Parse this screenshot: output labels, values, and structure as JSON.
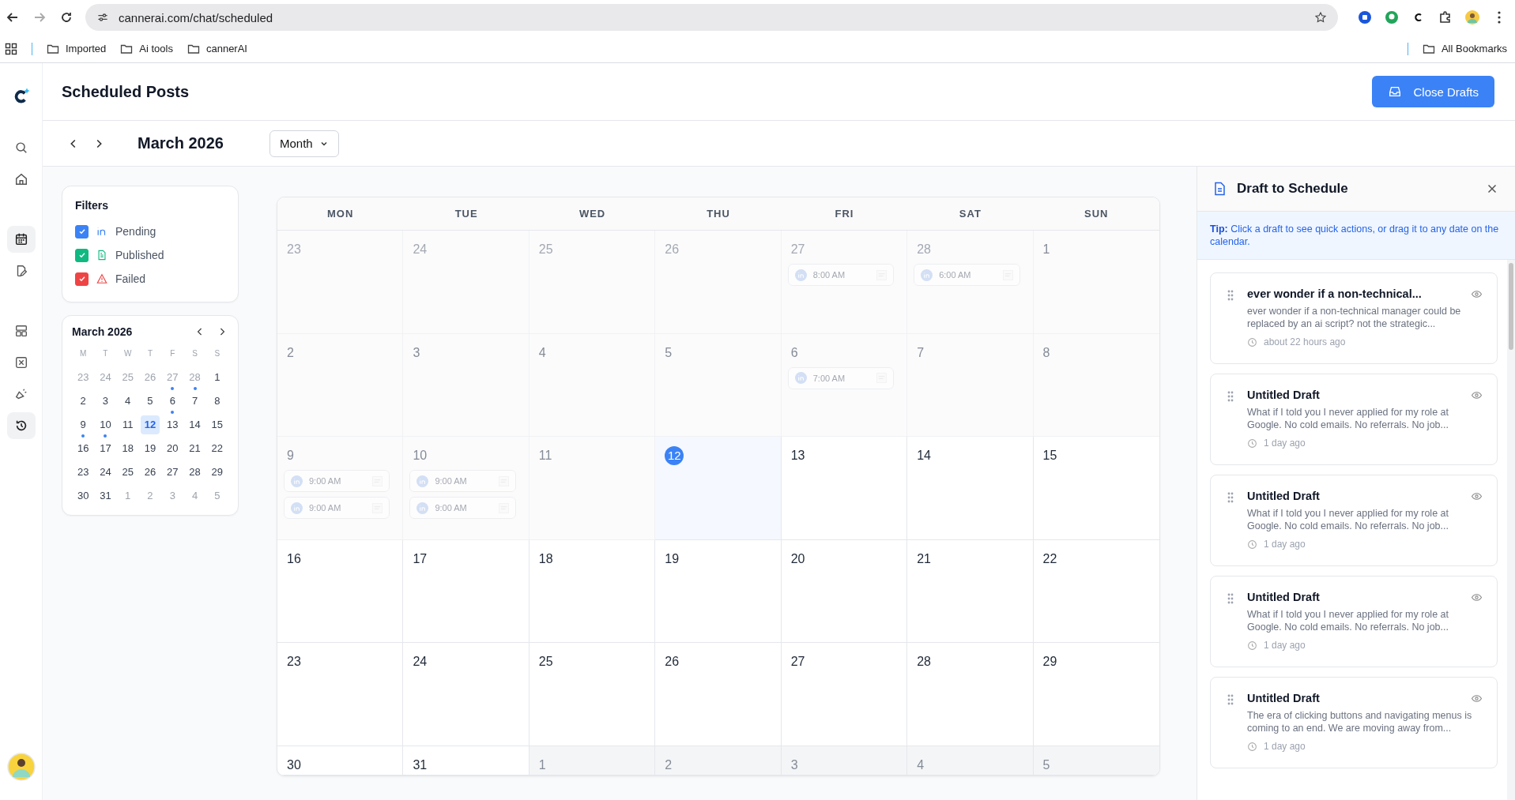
{
  "browser": {
    "url": "cannerai.com/chat/scheduled",
    "bookmarks": [
      {
        "label": "Imported"
      },
      {
        "label": "Ai tools"
      },
      {
        "label": "cannerAI"
      }
    ],
    "all_bookmarks": "All Bookmarks"
  },
  "sidebar": {
    "items": [
      {
        "kind": "search",
        "selected": false
      },
      {
        "kind": "home",
        "selected": false
      },
      {
        "kind": "calendar",
        "selected": true
      },
      {
        "kind": "edit",
        "selected": false
      },
      {
        "kind": "layout",
        "selected": false
      },
      {
        "kind": "box",
        "selected": false
      },
      {
        "kind": "megaphone",
        "selected": false
      },
      {
        "kind": "history",
        "selected": true
      }
    ]
  },
  "header": {
    "title": "Scheduled Posts",
    "button": "Close Drafts"
  },
  "toolbar": {
    "month": "March 2026",
    "view": "Month"
  },
  "filters": {
    "title": "Filters",
    "items": [
      {
        "kind": "linkedin",
        "label": "Pending",
        "checked": true,
        "color": "#3b82f6"
      },
      {
        "kind": "document",
        "label": "Published",
        "checked": true,
        "color": "#10b981"
      },
      {
        "kind": "warning",
        "label": "Failed",
        "checked": true,
        "color": "#ef4444"
      }
    ]
  },
  "mini_calendar": {
    "title": "March 2026",
    "weekdays": [
      "M",
      "T",
      "W",
      "T",
      "F",
      "S",
      "S"
    ],
    "days": [
      {
        "label": "23",
        "outside": true,
        "selected": false,
        "has_posts": false
      },
      {
        "label": "24",
        "outside": true,
        "selected": false,
        "has_posts": false
      },
      {
        "label": "25",
        "outside": true,
        "selected": false,
        "has_posts": false
      },
      {
        "label": "26",
        "outside": true,
        "selected": false,
        "has_posts": false
      },
      {
        "label": "27",
        "outside": true,
        "selected": false,
        "has_posts": true
      },
      {
        "label": "28",
        "outside": true,
        "selected": false,
        "has_posts": true
      },
      {
        "label": "1",
        "outside": false,
        "selected": false,
        "has_posts": false
      },
      {
        "label": "2",
        "outside": false,
        "selected": false,
        "has_posts": false
      },
      {
        "label": "3",
        "outside": false,
        "selected": false,
        "has_posts": false
      },
      {
        "label": "4",
        "outside": false,
        "selected": false,
        "has_posts": false
      },
      {
        "label": "5",
        "outside": false,
        "selected": false,
        "has_posts": false
      },
      {
        "label": "6",
        "outside": false,
        "selected": false,
        "has_posts": true
      },
      {
        "label": "7",
        "outside": false,
        "selected": false,
        "has_posts": false
      },
      {
        "label": "8",
        "outside": false,
        "selected": false,
        "has_posts": false
      },
      {
        "label": "9",
        "outside": false,
        "selected": false,
        "has_posts": true
      },
      {
        "label": "10",
        "outside": false,
        "selected": false,
        "has_posts": true
      },
      {
        "label": "11",
        "outside": false,
        "selected": false,
        "has_posts": false
      },
      {
        "label": "12",
        "outside": false,
        "selected": true,
        "has_posts": false
      },
      {
        "label": "13",
        "outside": false,
        "selected": false,
        "has_posts": false
      },
      {
        "label": "14",
        "outside": false,
        "selected": false,
        "has_posts": false
      },
      {
        "label": "15",
        "outside": false,
        "selected": false,
        "has_posts": false
      },
      {
        "label": "16",
        "outside": false,
        "selected": false,
        "has_posts": false
      },
      {
        "label": "17",
        "outside": false,
        "selected": false,
        "has_posts": false
      },
      {
        "label": "18",
        "outside": false,
        "selected": false,
        "has_posts": false
      },
      {
        "label": "19",
        "outside": false,
        "selected": false,
        "has_posts": false
      },
      {
        "label": "20",
        "outside": false,
        "selected": false,
        "has_posts": false
      },
      {
        "label": "21",
        "outside": false,
        "selected": false,
        "has_posts": false
      },
      {
        "label": "22",
        "outside": false,
        "selected": false,
        "has_posts": false
      },
      {
        "label": "23",
        "outside": false,
        "selected": false,
        "has_posts": false
      },
      {
        "label": "24",
        "outside": false,
        "selected": false,
        "has_posts": false
      },
      {
        "label": "25",
        "outside": false,
        "selected": false,
        "has_posts": false
      },
      {
        "label": "26",
        "outside": false,
        "selected": false,
        "has_posts": false
      },
      {
        "label": "27",
        "outside": false,
        "selected": false,
        "has_posts": false
      },
      {
        "label": "28",
        "outside": false,
        "selected": false,
        "has_posts": false
      },
      {
        "label": "29",
        "outside": false,
        "selected": false,
        "has_posts": false
      },
      {
        "label": "30",
        "outside": false,
        "selected": false,
        "has_posts": false
      },
      {
        "label": "31",
        "outside": false,
        "selected": false,
        "has_posts": false
      },
      {
        "label": "1",
        "outside": true,
        "selected": false,
        "has_posts": false
      },
      {
        "label": "2",
        "outside": true,
        "selected": false,
        "has_posts": false
      },
      {
        "label": "3",
        "outside": true,
        "selected": false,
        "has_posts": false
      },
      {
        "label": "4",
        "outside": true,
        "selected": false,
        "has_posts": false
      },
      {
        "label": "5",
        "outside": true,
        "selected": false,
        "has_posts": false
      }
    ]
  },
  "calendar": {
    "weekdays": [
      "MON",
      "TUE",
      "WED",
      "THU",
      "FRI",
      "SAT",
      "SUN"
    ],
    "days": [
      {
        "label": "23",
        "past": true,
        "outside": true,
        "today": false
      },
      {
        "label": "24",
        "past": true,
        "outside": true,
        "today": false
      },
      {
        "label": "25",
        "past": true,
        "outside": true,
        "today": false
      },
      {
        "label": "26",
        "past": true,
        "outside": true,
        "today": false
      },
      {
        "label": "27",
        "past": true,
        "outside": true,
        "today": false,
        "events": [
          {
            "time": "8:00 AM"
          }
        ]
      },
      {
        "label": "28",
        "past": true,
        "outside": true,
        "today": false,
        "events": [
          {
            "time": "6:00 AM"
          }
        ]
      },
      {
        "label": "1",
        "past": true,
        "outside": false,
        "today": false
      },
      {
        "label": "2",
        "past": true,
        "outside": false,
        "today": false
      },
      {
        "label": "3",
        "past": true,
        "outside": false,
        "today": false
      },
      {
        "label": "4",
        "past": true,
        "outside": false,
        "today": false
      },
      {
        "label": "5",
        "past": true,
        "outside": false,
        "today": false
      },
      {
        "label": "6",
        "past": true,
        "outside": false,
        "today": false,
        "events": [
          {
            "time": "7:00 AM"
          }
        ]
      },
      {
        "label": "7",
        "past": true,
        "outside": false,
        "today": false
      },
      {
        "label": "8",
        "past": true,
        "outside": false,
        "today": false
      },
      {
        "label": "9",
        "past": true,
        "outside": false,
        "today": false,
        "events": [
          {
            "time": "9:00 AM"
          },
          {
            "time": "9:00 AM"
          }
        ]
      },
      {
        "label": "10",
        "past": true,
        "outside": false,
        "today": false,
        "events": [
          {
            "time": "9:00 AM"
          },
          {
            "time": "9:00 AM"
          }
        ]
      },
      {
        "label": "11",
        "past": true,
        "outside": false,
        "today": false
      },
      {
        "label": "12",
        "past": false,
        "outside": false,
        "today": true
      },
      {
        "label": "13",
        "past": false,
        "outside": false,
        "today": false
      },
      {
        "label": "14",
        "past": false,
        "outside": false,
        "today": false
      },
      {
        "label": "15",
        "past": false,
        "outside": false,
        "today": false
      },
      {
        "label": "16",
        "past": false,
        "outside": false,
        "today": false
      },
      {
        "label": "17",
        "past": false,
        "outside": false,
        "today": false
      },
      {
        "label": "18",
        "past": false,
        "outside": false,
        "today": false
      },
      {
        "label": "19",
        "past": false,
        "outside": false,
        "today": false
      },
      {
        "label": "20",
        "past": false,
        "outside": false,
        "today": false
      },
      {
        "label": "21",
        "past": false,
        "outside": false,
        "today": false
      },
      {
        "label": "22",
        "past": false,
        "outside": false,
        "today": false
      },
      {
        "label": "23",
        "past": false,
        "outside": false,
        "today": false
      },
      {
        "label": "24",
        "past": false,
        "outside": false,
        "today": false
      },
      {
        "label": "25",
        "past": false,
        "outside": false,
        "today": false
      },
      {
        "label": "26",
        "past": false,
        "outside": false,
        "today": false
      },
      {
        "label": "27",
        "past": false,
        "outside": false,
        "today": false
      },
      {
        "label": "28",
        "past": false,
        "outside": false,
        "today": false
      },
      {
        "label": "29",
        "past": false,
        "outside": false,
        "today": false
      },
      {
        "label": "30",
        "past": false,
        "outside": false,
        "today": false
      },
      {
        "label": "31",
        "past": false,
        "outside": false,
        "today": false
      },
      {
        "label": "1",
        "past": false,
        "outside": true,
        "today": false
      },
      {
        "label": "2",
        "past": false,
        "outside": true,
        "today": false
      },
      {
        "label": "3",
        "past": false,
        "outside": true,
        "today": false
      },
      {
        "label": "4",
        "past": false,
        "outside": true,
        "today": false
      },
      {
        "label": "5",
        "past": false,
        "outside": true,
        "today": false
      }
    ]
  },
  "drafts_panel": {
    "title": "Draft to Schedule",
    "tip_label": "Tip:",
    "tip_text": "Click a draft to see quick actions, or drag it to any date on the calendar.",
    "drafts": [
      {
        "title": "ever wonder if a non-technical...",
        "excerpt": "ever wonder if a non-technical manager could be replaced by an ai script? not the strategic...",
        "time": "about 22 hours ago"
      },
      {
        "title": "Untitled Draft",
        "excerpt": "What if I told you I never applied for my role at Google. No cold emails. No referrals. No job...",
        "time": "1 day ago"
      },
      {
        "title": "Untitled Draft",
        "excerpt": "What if I told you I never applied for my role at Google. No cold emails. No referrals. No job...",
        "time": "1 day ago"
      },
      {
        "title": "Untitled Draft",
        "excerpt": "What if I told you I never applied for my role at Google. No cold emails. No referrals. No job...",
        "time": "1 day ago"
      },
      {
        "title": "Untitled Draft",
        "excerpt": "The era of clicking buttons and navigating menus is coming to an end. We are moving away from...",
        "time": "1 day ago"
      }
    ]
  }
}
